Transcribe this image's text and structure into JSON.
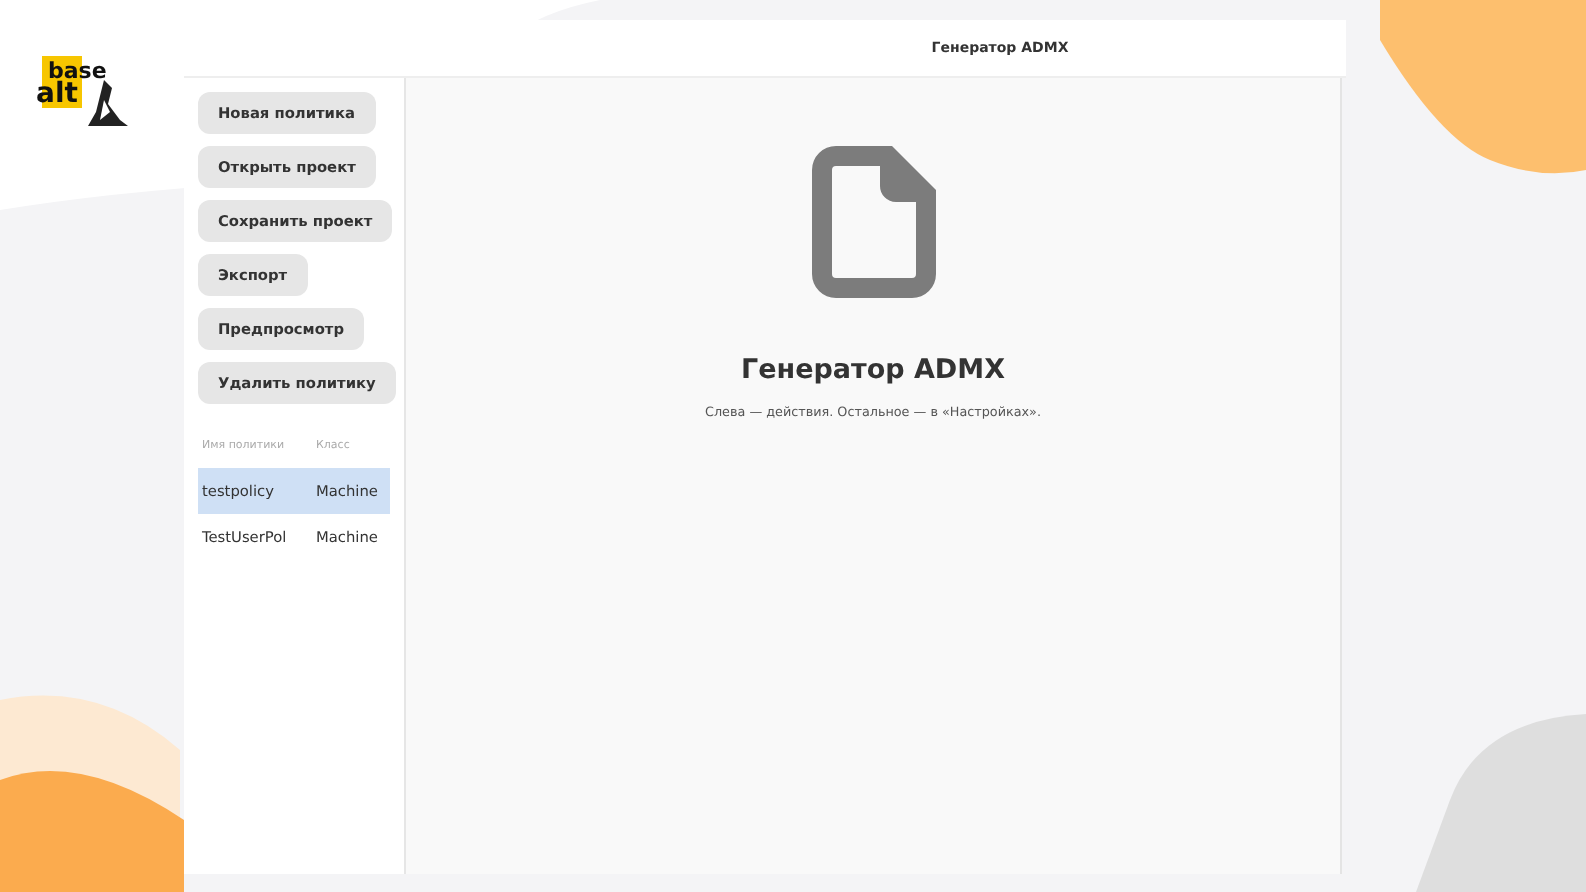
{
  "logo": {
    "line_1": "base",
    "line_2": "alt"
  },
  "window": {
    "title": "Генератор ADMX"
  },
  "actions": [
    {
      "label": "Новая политика"
    },
    {
      "label": "Открыть проект"
    },
    {
      "label": "Сохранить проект"
    },
    {
      "label": "Экспорт"
    },
    {
      "label": "Предпросмотр"
    },
    {
      "label": "Удалить политику"
    }
  ],
  "policies": {
    "columns": [
      "Имя политики",
      "Класс"
    ],
    "rows": [
      {
        "cells": [
          "testpolicy",
          "Machine"
        ],
        "selected": true
      },
      {
        "cells": [
          "TestUserPol",
          "Machine"
        ],
        "selected": false
      }
    ]
  },
  "welcome": {
    "heading": "Генератор ADMX",
    "hint": "Слева — действия. Остальное — в «Настройках»."
  }
}
